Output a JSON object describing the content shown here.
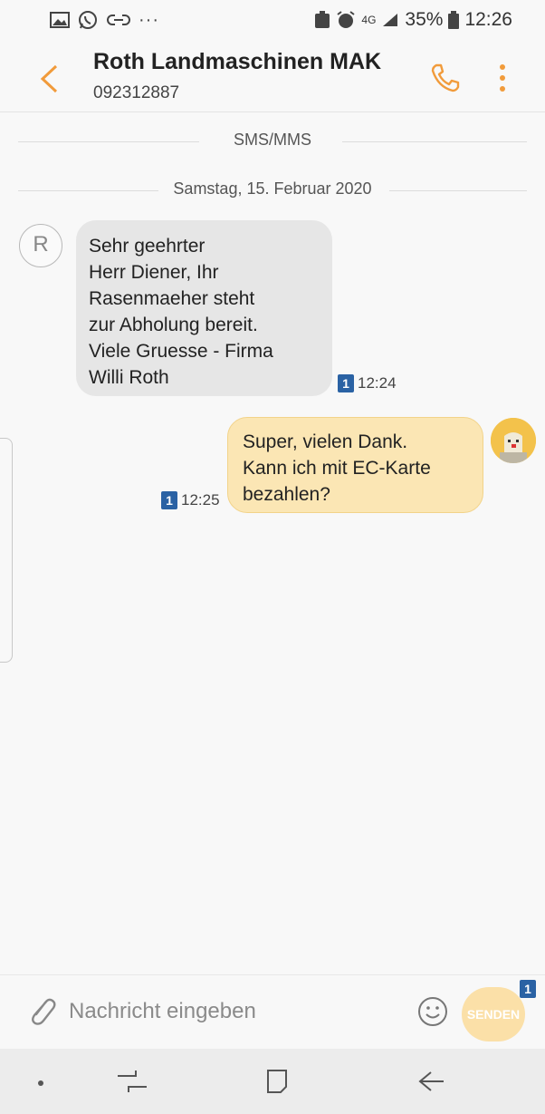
{
  "status_bar": {
    "left_icons": [
      "gallery-icon",
      "whatsapp-icon",
      "link-icon",
      "more-notifications-icon"
    ],
    "more_text": "···",
    "network": "4G",
    "battery": "35%",
    "time": "12:26"
  },
  "header": {
    "title": "Roth Landmaschinen MAK",
    "subtitle": "092312887",
    "accent_color": "#f19b3b"
  },
  "conversation": {
    "channel_label": "SMS/MMS",
    "date_label": "Samstag, 15. Februar 2020",
    "messages": [
      {
        "direction": "incoming",
        "avatar_letter": "R",
        "text": "Sehr geehrter\nHerr Diener, Ihr\nRasenmaeher steht\nzur Abholung bereit.\nViele Gruesse - Firma\nWilli Roth",
        "sim": "1",
        "time": "12:24"
      },
      {
        "direction": "outgoing",
        "text": "Super, vielen Dank.\nKann ich mit EC-Karte\nbezahlen?",
        "sim": "1",
        "time": "12:25"
      }
    ]
  },
  "composer": {
    "placeholder": "Nachricht eingeben",
    "send_label": "SENDEN",
    "send_sim": "1"
  },
  "nav_bar": {
    "buttons": [
      "dot-icon",
      "recents-icon",
      "home-icon",
      "back-icon"
    ]
  }
}
